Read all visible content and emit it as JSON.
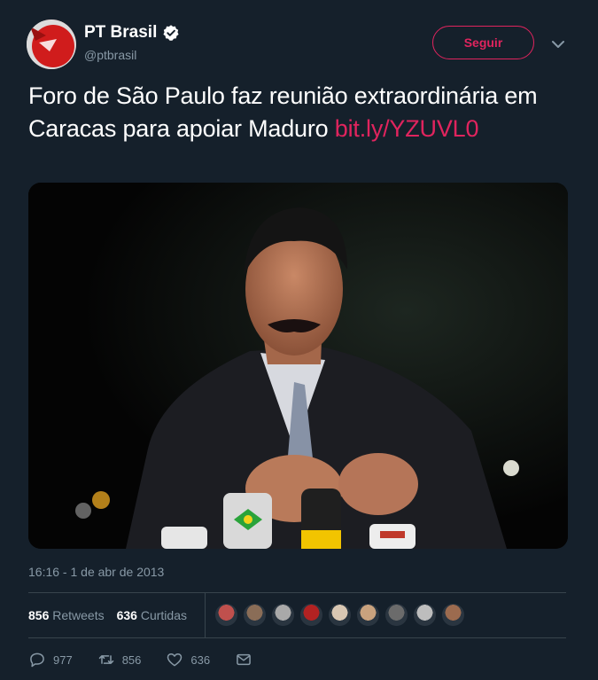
{
  "account": {
    "name": "PT Brasil",
    "handle": "@ptbrasil",
    "follow_label": "Seguir"
  },
  "tweet": {
    "text": "Foro de São Paulo faz reunião extraordinária em Caracas para apoiar Maduro ",
    "link": "bit.ly/YZUVL0",
    "timestamp": "16:16 - 1 de abr de 2013"
  },
  "stats": {
    "retweets_count": "856",
    "retweets_label": "Retweets",
    "likes_count": "636",
    "likes_label": "Curtidas"
  },
  "likers": [
    {
      "color": "#c0504d"
    },
    {
      "color": "#8a6d57"
    },
    {
      "color": "#a9a9a9"
    },
    {
      "color": "#b22222"
    },
    {
      "color": "#d8c7b3"
    },
    {
      "color": "#c9a27e"
    },
    {
      "color": "#6b6b6b"
    },
    {
      "color": "#bdbdbd"
    },
    {
      "color": "#9c6b4f"
    }
  ],
  "actions": {
    "replies": "977",
    "retweets": "856",
    "likes": "636"
  },
  "colors": {
    "background": "#15202b",
    "accent": "#e0245e",
    "secondary_text": "#8899a6",
    "verified": "#ffffff"
  },
  "icons": [
    "verified-badge-icon",
    "chevron-down-icon",
    "reply-icon",
    "retweet-icon",
    "like-icon",
    "message-icon"
  ]
}
